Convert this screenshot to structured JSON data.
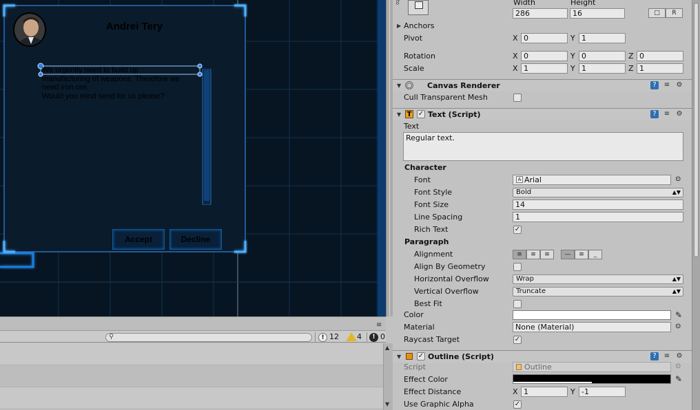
{
  "scene": {
    "npc_name": "Andrei Tery",
    "dialog_text": "We urgently need to build up\nmanufacturing of weapons. Therefore we\nneed iron ore.\nWould you mind send for us please?",
    "accept_label": "Accept",
    "decline_label": "Decline"
  },
  "console": {
    "menu_glyph": "≡",
    "search_placeholder": "",
    "info_count": "12",
    "warning_count": "4",
    "error_count": "0",
    "info_glyph": "!",
    "warning_glyph": "!",
    "error_glyph": "!"
  },
  "inspector": {
    "rect": {
      "width_label": "Width",
      "height_label": "Height",
      "width_value": "286",
      "height_value": "16",
      "r_button": "R",
      "anchors_label": "Anchors",
      "pivot_label": "Pivot",
      "pivot_x": "0",
      "pivot_y": "1",
      "rotation_label": "Rotation",
      "rotation_x": "0",
      "rotation_y": "0",
      "rotation_z": "0",
      "scale_label": "Scale",
      "scale_x": "1",
      "scale_y": "1",
      "scale_z": "1",
      "x": "X",
      "y": "Y",
      "z": "Z"
    },
    "canvas_renderer": {
      "title": "Canvas Renderer",
      "cull_label": "Cull Transparent Mesh"
    },
    "text_script": {
      "title": "Text (Script)",
      "text_label": "Text",
      "text_value": "Regular text.",
      "character_label": "Character",
      "font_label": "Font",
      "font_value": "Arial",
      "font_style_label": "Font Style",
      "font_style_value": "Bold",
      "font_size_label": "Font Size",
      "font_size_value": "14",
      "line_spacing_label": "Line Spacing",
      "line_spacing_value": "1",
      "rich_text_label": "Rich Text",
      "paragraph_label": "Paragraph",
      "alignment_label": "Alignment",
      "align_geometry_label": "Align By Geometry",
      "h_overflow_label": "Horizontal Overflow",
      "h_overflow_value": "Wrap",
      "v_overflow_label": "Vertical Overflow",
      "v_overflow_value": "Truncate",
      "best_fit_label": "Best Fit",
      "color_label": "Color",
      "color_value": "#ffffff",
      "material_label": "Material",
      "material_value": "None (Material)",
      "raycast_label": "Raycast Target"
    },
    "outline": {
      "title": "Outline (Script)",
      "script_label": "Script",
      "script_value": "Outline",
      "effect_color_label": "Effect Color",
      "effect_color_value": "#000000",
      "effect_distance_label": "Effect Distance",
      "distance_x": "1",
      "distance_y": "-1",
      "graphic_alpha_label": "Use Graphic Alpha"
    },
    "check_glyph": "✓"
  },
  "colors": {
    "scene_bg": "#071522",
    "neon_blue": "#1a7fe0",
    "panel_bg": "#c2c2c2"
  }
}
